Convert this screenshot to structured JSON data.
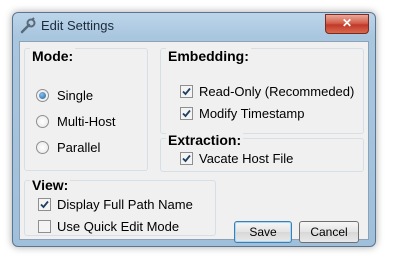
{
  "window": {
    "title": "Edit Settings",
    "close_glyph": "✕",
    "icons": {
      "title": "wrench-icon",
      "close": "close-icon"
    }
  },
  "mode": {
    "title": "Mode:",
    "options": [
      {
        "label": "Single",
        "checked": true
      },
      {
        "label": "Multi-Host",
        "checked": false
      },
      {
        "label": "Parallel",
        "checked": false
      }
    ]
  },
  "embedding": {
    "title": "Embedding:",
    "options": [
      {
        "label": "Read-Only (Recommeded)",
        "checked": true
      },
      {
        "label": "Modify Timestamp",
        "checked": true
      }
    ]
  },
  "extraction": {
    "title": "Extraction:",
    "options": [
      {
        "label": "Vacate Host File",
        "checked": true
      }
    ]
  },
  "view": {
    "title": "View:",
    "options": [
      {
        "label": "Display Full Path Name",
        "checked": true
      },
      {
        "label": "Use Quick Edit Mode",
        "checked": false
      }
    ]
  },
  "buttons": {
    "save": "Save",
    "cancel": "Cancel"
  },
  "colors": {
    "title_bar": "#a9c6df",
    "client": "#f0f0f0",
    "close": "#c0392b"
  }
}
